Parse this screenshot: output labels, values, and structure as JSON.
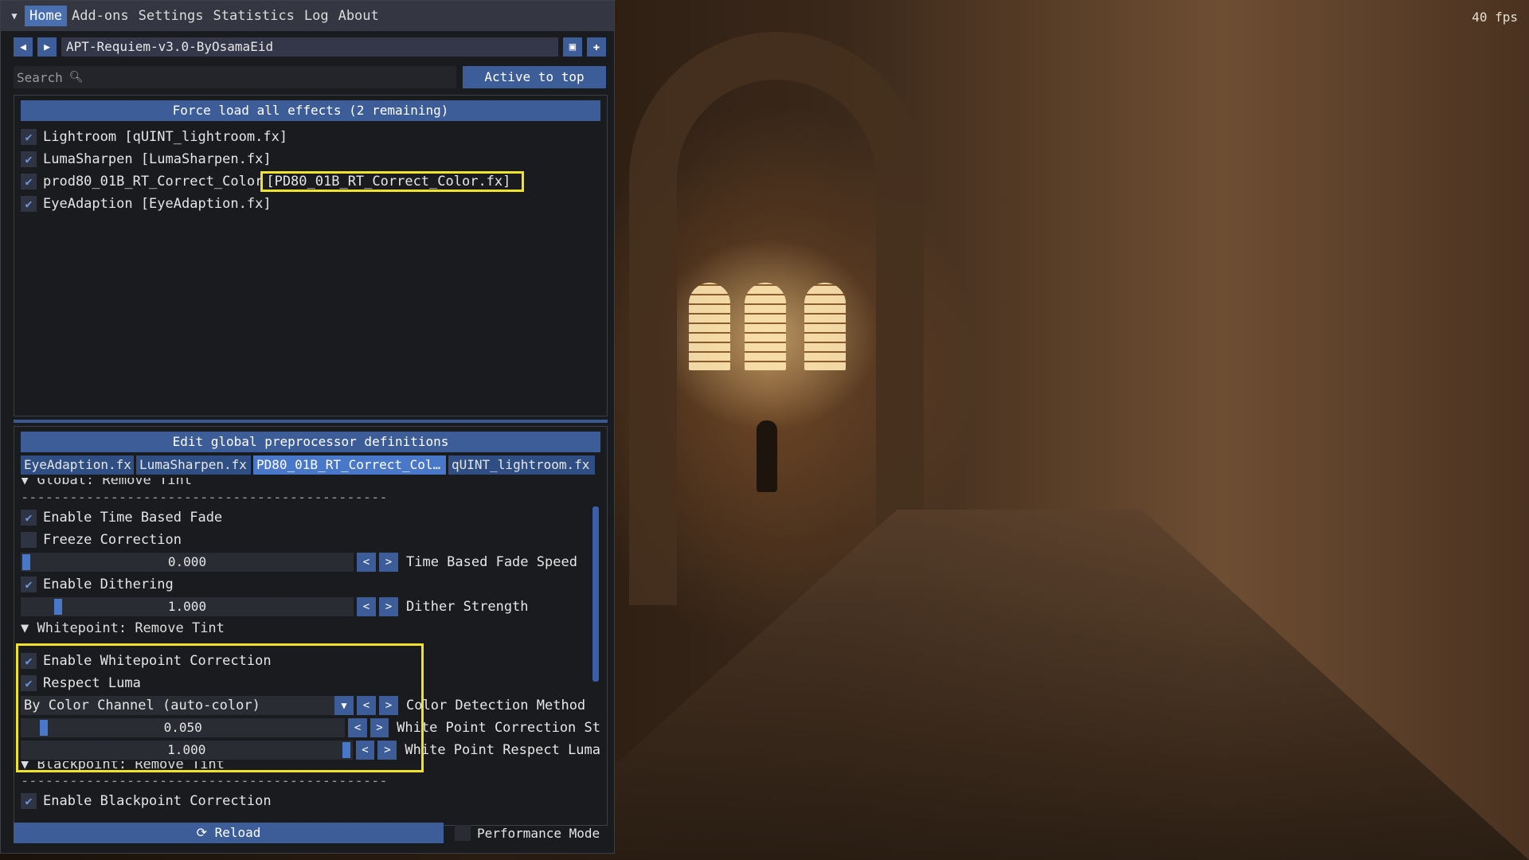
{
  "overlay": {
    "fps": "40 fps"
  },
  "menubar": {
    "items": [
      "Home",
      "Add-ons",
      "Settings",
      "Statistics",
      "Log",
      "About"
    ],
    "active": "Home"
  },
  "preset": {
    "name": "APT-Requiem-v3.0-ByOsamaEid"
  },
  "search": {
    "placeholder": "Search",
    "active_to_top_label": "Active to top"
  },
  "effects": {
    "header": "Force load all effects (2 remaining)",
    "items": [
      {
        "label": "Lightroom [qUINT_lightroom.fx]",
        "enabled": true
      },
      {
        "label": "LumaSharpen [LumaSharpen.fx]",
        "enabled": true
      },
      {
        "label": "prod80_01B_RT_Correct_Color",
        "file": "[PD80_01B_RT_Correct_Color.fx]",
        "enabled": true
      },
      {
        "label": "EyeAdaption [EyeAdaption.fx]",
        "enabled": true
      }
    ]
  },
  "preprocessor": {
    "header": "Edit global preprocessor definitions",
    "tabs": [
      "EyeAdaption.fx",
      "LumaSharpen.fx",
      "PD80_01B_RT_Correct_Col…",
      "qUINT_lightroom.fx"
    ],
    "active_tab": "PD80_01B_RT_Correct_Col…"
  },
  "params": {
    "global_header": "Global: Remove Tint",
    "dashes": "---------------------------------------------",
    "enable_time_fade": {
      "label": "Enable Time Based Fade",
      "checked": true
    },
    "freeze_correction": {
      "label": "Freeze Correction",
      "checked": false
    },
    "time_fade_speed": {
      "value": "0.000",
      "label": "Time Based Fade Speed"
    },
    "enable_dithering": {
      "label": "Enable Dithering",
      "checked": true
    },
    "dither_strength": {
      "value": "1.000",
      "label": "Dither Strength"
    },
    "whitepoint_header": "Whitepoint: Remove Tint",
    "enable_whitepoint": {
      "label": "Enable Whitepoint Correction",
      "checked": true
    },
    "respect_luma": {
      "label": "Respect Luma",
      "checked": true
    },
    "color_detection": {
      "value": "By Color Channel (auto-color)",
      "label": "Color Detection Method"
    },
    "wp_correction_strength": {
      "value": "0.050",
      "label": "White Point Correction St"
    },
    "wp_respect_luma": {
      "value": "1.000",
      "label": "White Point Respect Luma"
    },
    "blackpoint_header": "Blackpoint: Remove Tint",
    "enable_blackpoint": {
      "label": "Enable Blackpoint Correction",
      "checked": true
    }
  },
  "bottom": {
    "reload_label": "Reload",
    "performance_mode_label": "Performance Mode",
    "performance_mode_checked": false
  },
  "colors": {
    "accent": "#3c5d97",
    "highlight": "#f0e12a",
    "panel_bg": "#191b1f"
  }
}
